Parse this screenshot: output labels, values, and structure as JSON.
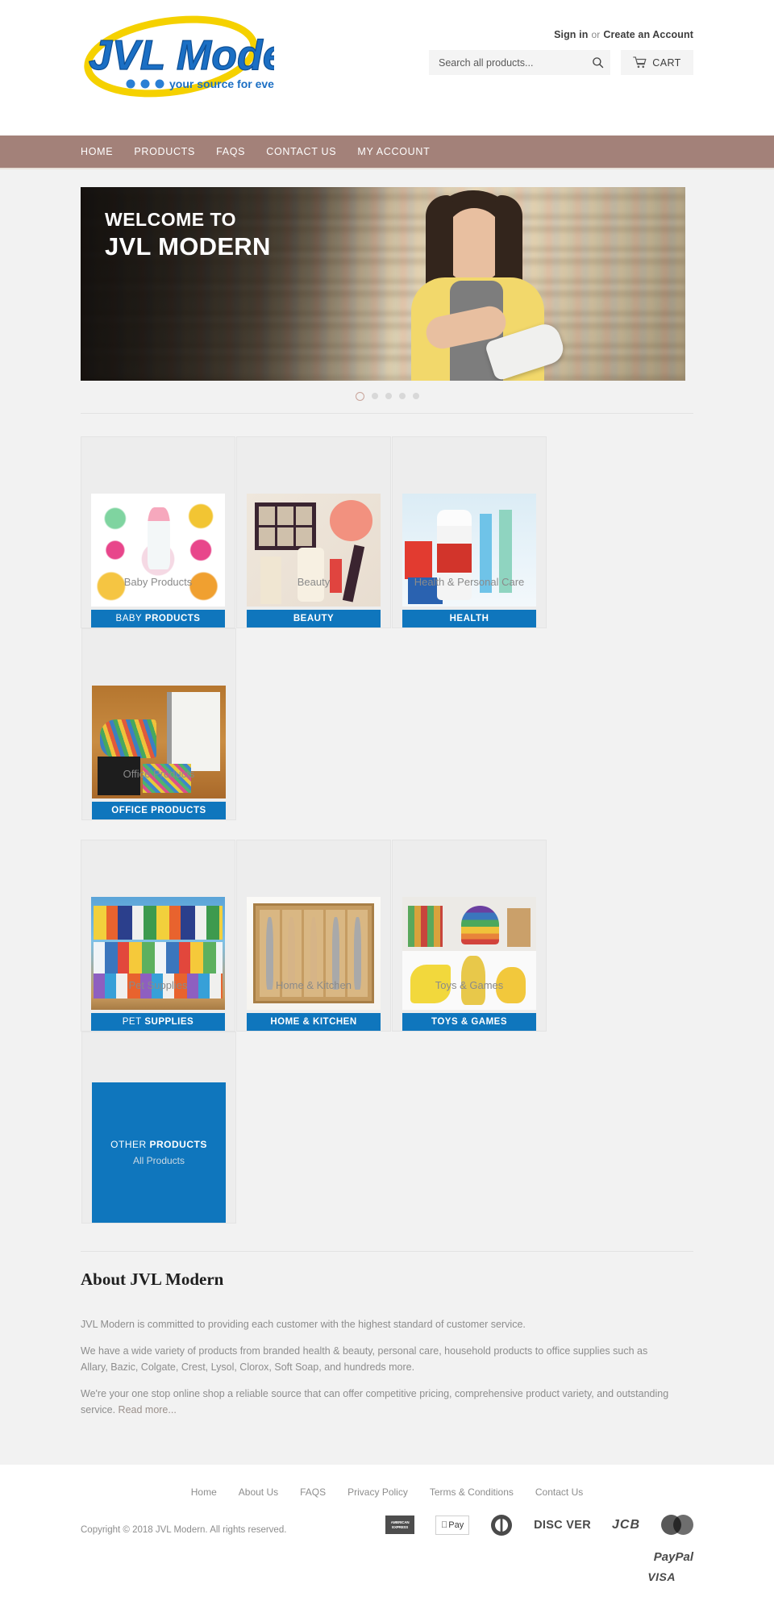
{
  "header": {
    "logo": {
      "name": "JVL Modern",
      "tagline": "your source for everything"
    },
    "account": {
      "sign_in": "Sign in",
      "or": "or",
      "create_account": "Create an Account"
    },
    "search": {
      "placeholder": "Search all products...",
      "value": "",
      "icon": "search-icon"
    },
    "cart": {
      "label": "CART",
      "icon": "shopping-cart-icon"
    }
  },
  "nav": {
    "items": [
      {
        "label": "HOME"
      },
      {
        "label": "PRODUCTS"
      },
      {
        "label": "FAQS"
      },
      {
        "label": "CONTACT US"
      },
      {
        "label": "MY ACCOUNT"
      }
    ],
    "background_color": "#a38179"
  },
  "hero": {
    "line1": "WELCOME TO",
    "line2": "JVL MODERN",
    "slides_total": 5,
    "active_slide": 1
  },
  "categories": {
    "accent_color": "#0f76bd",
    "tiles": [
      {
        "overlay": "Baby Products",
        "bar_thin": "BABY",
        "bar_bold": "PRODUCTS",
        "art": "art-baby"
      },
      {
        "overlay": "Beauty",
        "bar_thin": "",
        "bar_bold": "BEAUTY",
        "art": "art-beauty"
      },
      {
        "overlay": "Health & Personal Care",
        "bar_thin": "",
        "bar_bold": "HEALTH",
        "art": "art-health"
      },
      {
        "overlay": "Office Products",
        "bar_thin": "",
        "bar_bold": "OFFICE PRODUCTS",
        "art": "art-office"
      },
      {
        "overlay": "Pet Supplies",
        "bar_thin": "PET",
        "bar_bold": "SUPPLIES",
        "art": "art-pet"
      },
      {
        "overlay": "Home & Kitchen",
        "bar_thin": "",
        "bar_bold": "HOME & KITCHEN",
        "art": "art-kitchen"
      },
      {
        "overlay": "Toys & Games",
        "bar_thin": "",
        "bar_bold": "TOYS & GAMES",
        "art": "art-toys"
      }
    ],
    "other": {
      "title_thin": "OTHER ",
      "title_bold": "PRODUCTS",
      "subtitle": "All Products"
    }
  },
  "about": {
    "title": "About JVL Modern",
    "paragraph1": "JVL Modern is committed to providing each customer with the highest standard of customer service.",
    "paragraph2": "We have a wide variety of products from branded health & beauty, personal care, household products to office supplies such as Allary, Bazic, Colgate, Crest, Lysol, Clorox, Soft Soap, and hundreds more.",
    "paragraph3": "We're your one stop online shop a reliable source that can offer competitive pricing, comprehensive product variety, and outstanding service. ",
    "read_more": "Read more..."
  },
  "footer": {
    "links": [
      {
        "label": "Home"
      },
      {
        "label": "About Us"
      },
      {
        "label": "FAQS"
      },
      {
        "label": "Privacy Policy"
      },
      {
        "label": "Terms & Conditions"
      },
      {
        "label": "Contact Us"
      }
    ],
    "copyright": "Copyright © 2018 JVL Modern. All rights reserved.",
    "payments": [
      {
        "name": "american-express",
        "label": "AMERICAN EXPRESS"
      },
      {
        "name": "apple-pay",
        "label": "Pay"
      },
      {
        "name": "diners-club",
        "label": ""
      },
      {
        "name": "discover",
        "label": "DISC VER"
      },
      {
        "name": "jcb",
        "label": "JCB"
      },
      {
        "name": "mastercard",
        "label": ""
      },
      {
        "name": "paypal",
        "label": "PayPal"
      },
      {
        "name": "visa",
        "label": "VISA"
      }
    ]
  }
}
